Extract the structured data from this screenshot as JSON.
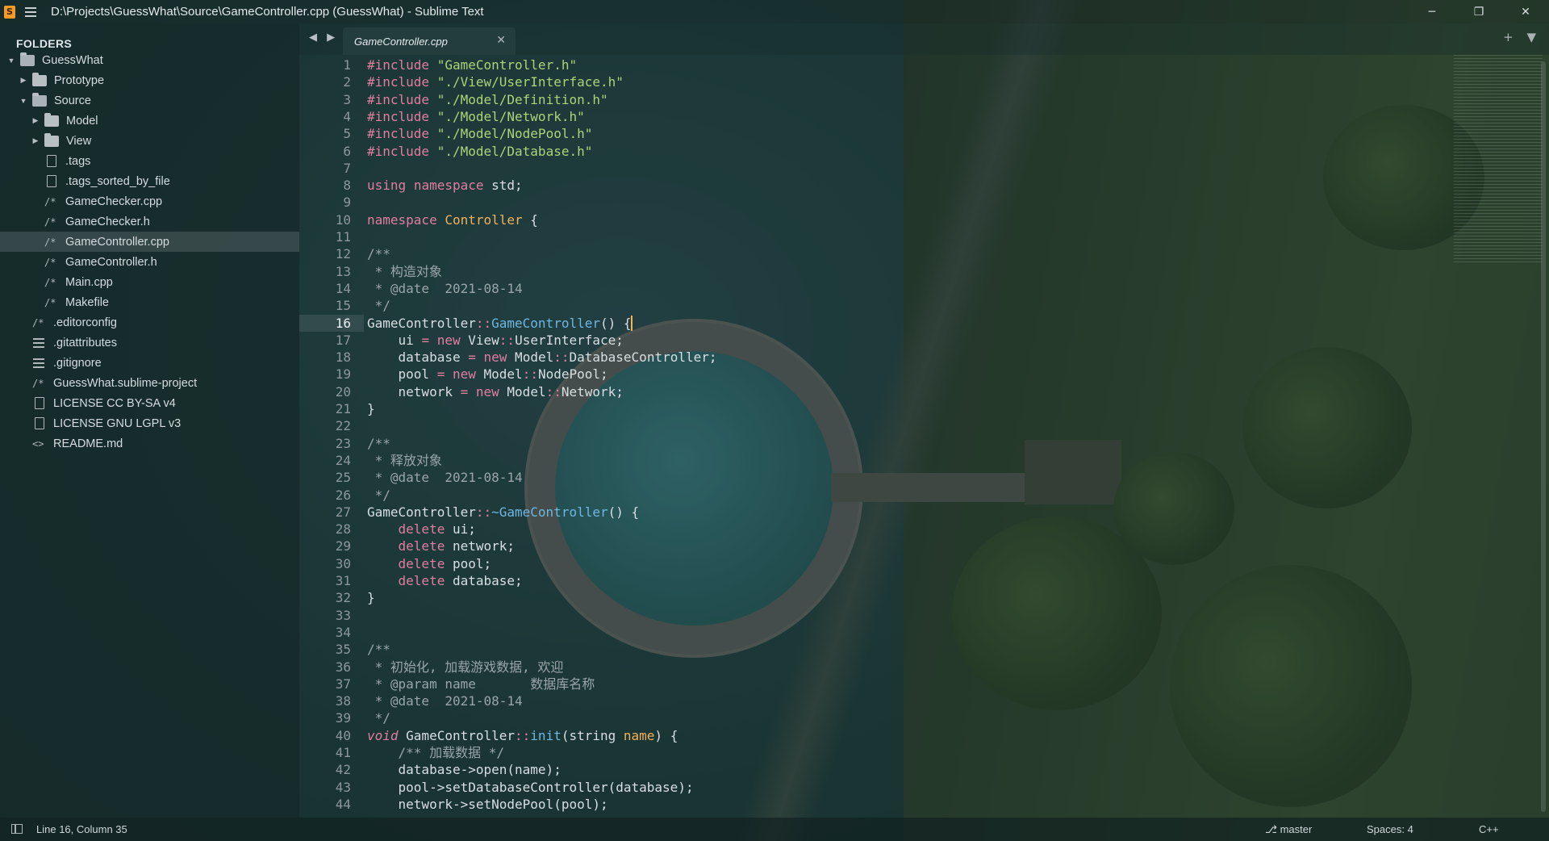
{
  "window": {
    "title": "D:\\Projects\\GuessWhat\\Source\\GameController.cpp (GuessWhat) - Sublime Text",
    "controls": [
      "─",
      "❐",
      "✕"
    ]
  },
  "sidebar": {
    "header": "FOLDERS",
    "items": [
      {
        "label": "GuessWhat",
        "kind": "folder-open",
        "level": 0,
        "disclosure": "▼"
      },
      {
        "label": "Prototype",
        "kind": "folder",
        "level": 1,
        "disclosure": "▶"
      },
      {
        "label": "Source",
        "kind": "folder-open",
        "level": 1,
        "disclosure": "▼"
      },
      {
        "label": "Model",
        "kind": "folder",
        "level": 2,
        "disclosure": "▶"
      },
      {
        "label": "View",
        "kind": "folder",
        "level": 2,
        "disclosure": "▶"
      },
      {
        "label": ".tags",
        "kind": "file",
        "level": 2
      },
      {
        "label": ".tags_sorted_by_file",
        "kind": "file",
        "level": 2
      },
      {
        "label": "GameChecker.cpp",
        "kind": "code",
        "level": 2
      },
      {
        "label": "GameChecker.h",
        "kind": "code",
        "level": 2
      },
      {
        "label": "GameController.cpp",
        "kind": "code",
        "level": 2,
        "selected": true
      },
      {
        "label": "GameController.h",
        "kind": "code",
        "level": 2
      },
      {
        "label": "Main.cpp",
        "kind": "code",
        "level": 2
      },
      {
        "label": "Makefile",
        "kind": "code",
        "level": 2
      },
      {
        "label": ".editorconfig",
        "kind": "code",
        "level": 1
      },
      {
        "label": ".gitattributes",
        "kind": "lines",
        "level": 1
      },
      {
        "label": ".gitignore",
        "kind": "lines",
        "level": 1
      },
      {
        "label": "GuessWhat.sublime-project",
        "kind": "code",
        "level": 1
      },
      {
        "label": "LICENSE CC BY-SA v4",
        "kind": "file",
        "level": 1
      },
      {
        "label": "LICENSE GNU LGPL v3",
        "kind": "file",
        "level": 1
      },
      {
        "label": "README.md",
        "kind": "markup",
        "level": 1
      }
    ]
  },
  "tabs": {
    "nav": "◀ ▶",
    "active": {
      "label": "GameController.cpp",
      "close": "✕"
    },
    "actions": "+ ▼"
  },
  "editor": {
    "current_line": 16,
    "lines": [
      "#include \"GameController.h\"",
      "#include \"./View/UserInterface.h\"",
      "#include \"./Model/Definition.h\"",
      "#include \"./Model/Network.h\"",
      "#include \"./Model/NodePool.h\"",
      "#include \"./Model/Database.h\"",
      "",
      "using namespace std;",
      "",
      "namespace Controller {",
      "",
      "/**",
      " * 构造对象",
      " * @date  2021-08-14",
      " */",
      "GameController::GameController() {",
      "    ui = new View::UserInterface;",
      "    database = new Model::DatabaseController;",
      "    pool = new Model::NodePool;",
      "    network = new Model::Network;",
      "}",
      "",
      "/**",
      " * 释放对象",
      " * @date  2021-08-14",
      " */",
      "GameController::~GameController() {",
      "    delete ui;",
      "    delete network;",
      "    delete pool;",
      "    delete database;",
      "}",
      "",
      "",
      "/**",
      " * 初始化, 加载游戏数据, 欢迎",
      " * @param name       数据库名称",
      " * @date  2021-08-14",
      " */",
      "void GameController::init(string name) {",
      "    /** 加载数据 */",
      "    database->open(name);",
      "    pool->setDatabaseController(database);",
      "    network->setNodePool(pool);"
    ]
  },
  "status": {
    "position": "Line 16, Column 35",
    "branch": "master",
    "spaces": "Spaces: 4",
    "syntax": "C++"
  },
  "colors": {
    "keyword": "#e07ea0",
    "string": "#a9d57a",
    "type": "#f0b15a",
    "function": "#6fb7e0",
    "comment": "#9aa5a9",
    "cursor": "#f3b54a"
  }
}
